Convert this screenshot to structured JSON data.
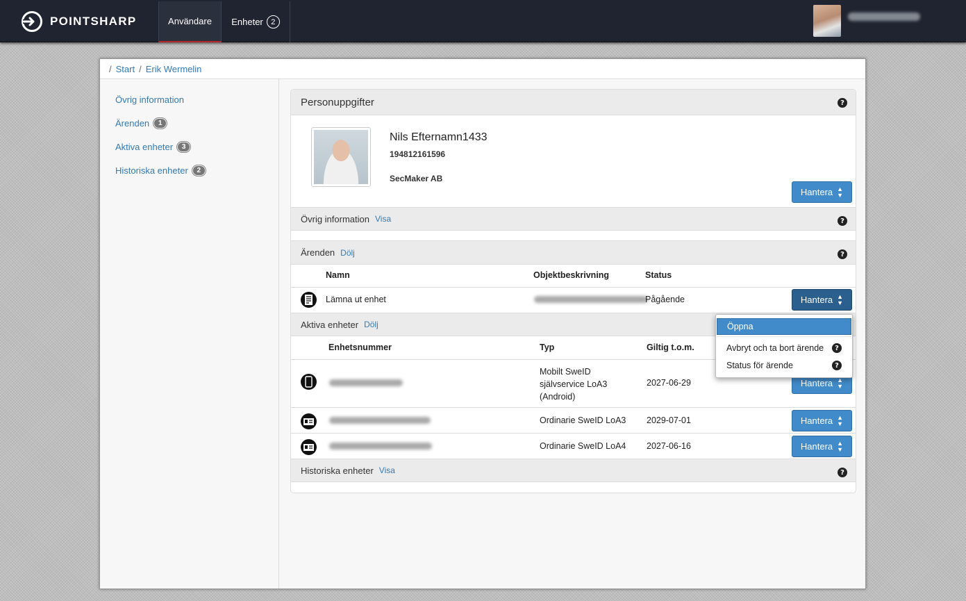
{
  "brand": {
    "name": "POINTSHARP"
  },
  "nav": {
    "tabs": [
      {
        "label": "Användare",
        "active": true
      },
      {
        "label": "Enheter",
        "count": "2"
      }
    ]
  },
  "breadcrumb": {
    "items": [
      "Start",
      "Erik Wermelin"
    ]
  },
  "sidebar": {
    "items": [
      {
        "label": "Övrig information"
      },
      {
        "label": "Ärenden",
        "count": "1"
      },
      {
        "label": "Aktiva enheter",
        "count": "3"
      },
      {
        "label": "Historiska enheter",
        "count": "2"
      }
    ]
  },
  "person": {
    "section_title": "Personuppgifter",
    "name": "Nils Efternamn1433",
    "id_number": "194812161596",
    "organization": "SecMaker AB",
    "manage_label": "Hantera"
  },
  "other_info": {
    "title": "Övrig information",
    "toggle": "Visa"
  },
  "cases": {
    "title": "Ärenden",
    "toggle": "Dölj",
    "columns": [
      "Namn",
      "Objektbeskrivning",
      "Status"
    ],
    "rows": [
      {
        "name": "Lämna ut enhet",
        "status": "Pågående",
        "action": "Hantera"
      }
    ]
  },
  "active_devices": {
    "title": "Aktiva enheter",
    "toggle": "Dölj",
    "columns": [
      "Enhetsnummer",
      "Typ",
      "Giltig t.o.m."
    ],
    "rows": [
      {
        "type_lines": [
          "Mobilt SweID",
          "självservice LoA3",
          "(Android)"
        ],
        "valid_until": "2027-06-29",
        "action": "Hantera",
        "icon": "mobile-phone-icon"
      },
      {
        "type": "Ordinarie SweID LoA3",
        "valid_until": "2029-07-01",
        "action": "Hantera",
        "icon": "id-card-icon"
      },
      {
        "type": "Ordinarie SweID LoA4",
        "valid_until": "2027-06-16",
        "action": "Hantera",
        "icon": "id-card-icon"
      }
    ]
  },
  "historic_devices": {
    "title": "Historiska enheter",
    "toggle": "Visa"
  },
  "dropdown": {
    "items": [
      "Öppna",
      "Avbryt och ta bort ärende",
      "Status för ärende"
    ]
  },
  "colors": {
    "primary": "#428bca",
    "topbar": "#1f2430",
    "accent": "#b3262b"
  }
}
